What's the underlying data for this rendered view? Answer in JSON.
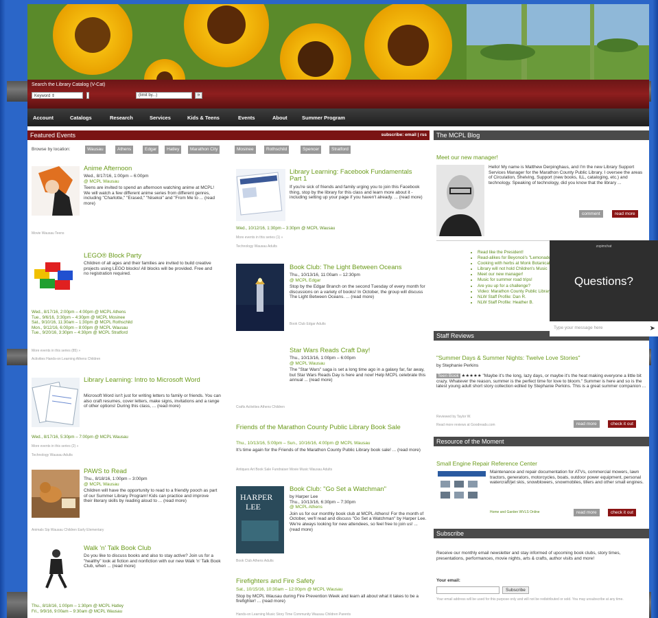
{
  "search": {
    "label": "Search the Library Catalog (V-Cat)",
    "field_select": "Keyword ⇕",
    "limit_select": "(limit by...)",
    "go": "»"
  },
  "nav": [
    "Account",
    "Catalogs",
    "Research",
    "Services",
    "Kids & Teens",
    "Events",
    "About",
    "Summer Program"
  ],
  "featured": {
    "title": "Featured Events",
    "subscribe": "subscribe: email | rss",
    "browse_label": "Browse by location:",
    "locations": [
      "Wausau",
      "Athens",
      "Edgar",
      "Hatley",
      "Marathon City",
      "Mosinee",
      "Rothschild",
      "Spencer",
      "Stratford"
    ]
  },
  "left_events": [
    {
      "title": "Anime Afternoon",
      "when": "Wed., 8/17/16, 1:00pm – 6:00pm",
      "where": "@ MCPL Wausau",
      "desc": "Teens are invited to spend an afternoon watching anime at MCPL! We will watch a few different anime series from different genres, including \"Charlotte,\" \"Erased,\" \"Nisekoi\" and \"From Me to ... (read more)",
      "tags": "Movie   Wausau   Teens"
    },
    {
      "title": "LEGO® Block Party",
      "desc": "Children of all ages and their families are invited to build creative projects using LEGO blocks! All blocks will be provided. Free and no registration required.",
      "dates": [
        "Wed., 8/17/16, 2:00pm – 4:00pm @ MCPL Athens",
        "Tue., 9/6/16, 3:30pm – 4:30pm @ MCPL Mosinee",
        "Sat., 9/10/16, 11:30am – 1:30pm @ MCPL Rothschild",
        "Mon., 9/12/16, 6:00pm – 8:00pm @ MCPL Wausau",
        "Tue., 9/20/16, 3:30pm – 4:30pm @ MCPL Stratford"
      ],
      "more": "More events in this series (85) »",
      "tags": "Activities   Hands-on Learning   Athens   Children"
    },
    {
      "title": "Library Learning: Intro to Microsoft Word",
      "desc": "Microsoft Word isn't just for writing letters to family or friends. You can also craft resumes, cover letters, make signs, invitations and a range of other options! During this class, ... (read more)",
      "dates": [
        "Wed., 8/17/16, 5:30pm – 7:00pm @ MCPL Wausau"
      ],
      "more": "More events in this series (2) »",
      "tags": "Technology   Wausau   Adults"
    },
    {
      "title": "PAWS to Read",
      "when": "Thu., 8/18/16, 1:00pm – 3:00pm",
      "where": "@ MCPL Wausau",
      "desc": "Children will have the opportunity to read to a friendly pooch as part of our Summer Library Program! Kids can practice and improve their literary skills by reading aloud to ... (read more)",
      "tags": "Animals   Sip   Wausau   Children   Early Elementary"
    },
    {
      "title": "Walk 'n' Talk Book Club",
      "desc": "Do you like to discuss books and also to stay active? Join us for a \"healthy\" look at fiction and nonfiction with our new Walk 'n' Talk Book Club, when ... (read more)",
      "dates": [
        "Thu., 8/18/16, 1:00pm – 1:30pm @ MCPL Hatley",
        "Fri., 9/9/16, 9:00am – 9:30am @ MCPL Wausau"
      ]
    }
  ],
  "mid_events": [
    {
      "title": "Library Learning: Facebook Fundamentals Part 1",
      "desc": "If you're sick of friends and family urging you to join this Facebook thing, stop by the library for this class and learn more about it - including setting up your page if you haven't already. ... (read more)",
      "dates": [
        "Wed., 10/12/16, 1:30pm – 3:30pm @ MCPL Wausau"
      ],
      "more": "More events in this series (1) »",
      "tags": "Technology   Wausau   Adults"
    },
    {
      "title": "Book Club: The Light Between Oceans",
      "when": "Thu., 10/13/16, 11:00am – 12:30pm",
      "where": "@ MCPL Edgar",
      "desc": "Stop by the Edgar Branch on the second Tuesday of every month for discussions on a variety of books! In October, the group will discuss The Light Between Oceans. ... (read more)",
      "tags": "Book Club   Edgar   Adults"
    },
    {
      "title": "Star Wars Reads Craft Day!",
      "when": "Thu., 10/13/16, 1:00pm – 6:00pm",
      "where": "@ MCPL Wausau",
      "desc": "The \"Star Wars\" saga is set a long time ago in a galaxy far, far away, but Star Wars Reads Day is here and now! Help MCPL celebrate this annual ... (read more)",
      "tags": "Crafts   Activities   Athens   Children"
    },
    {
      "title": "Friends of the Marathon County Public Library Book Sale",
      "when": "Thu., 10/13/16, 5:00pm – Sun., 10/16/16, 4:00pm @ MCPL Wausau",
      "desc": "It's time again for the Friends of the Marathon County Public Library book sale! ... (read more)",
      "tags": "Antiques   Art   Book Sale   Fundraiser   Movie   Music   Wausau   Adults"
    },
    {
      "title": "Book Club: \"Go Set a Watchman\"",
      "by": "by Harper Lee",
      "when": "Thu., 10/13/16, 6:30pm – 7:30pm",
      "where": "@ MCPL Athens",
      "desc": "Join us for our monthly book club at MCPL Athens! For the month of October, we'll read and discuss \"Go Set a Watchman\" by Harper Lee. We're always looking for new attendees, so feel free to join us! ... (read more)",
      "tags": "Book Club   Athens   Adults"
    },
    {
      "title": "Firefighters and Fire Safety",
      "when": "Sat., 10/15/16, 10:30am – 12:00pm @ MCPL Wausau",
      "desc": "Stop by MCPL Wausau during Fire Prevention Week and learn all about what it takes to be a firefighter! ... (read more)",
      "tags": "Hands-on Learning   Music   Story Time   Community   Wausau   Children   Parents"
    }
  ],
  "blog": {
    "title": "The MCPL Blog",
    "post_title": "Meet our new manager!",
    "post_text": "Hello! My name is Matthew Derpinghaus, and I'm the new Library Support Services Manager for the Marathon County Public Library. I oversee the areas of Circulation, Shelving, Support (new books, ILL, cataloging, etc.) and technology. Speaking of technology, did you know that the library ...",
    "comment": "comment",
    "read_more": "read more",
    "links": [
      "Read like the President!",
      "Read-alikes for Beyoncé's \"Lemonade\"",
      "Cooking with herbs at Monk Botanical Gardens",
      "Library will not hold Children's Music",
      "Meet our new manager!",
      "Music for summer road trips!",
      "Are you up for a challenge?",
      "Video: Marathon County Public Library",
      "NLW Staff Profile: Dan R.",
      "NLW Staff Profile: Heather B."
    ]
  },
  "chat": {
    "brand": "zopimchat",
    "question": "Questions?",
    "placeholder": "Type your message here",
    "send": "➤"
  },
  "reviews": {
    "title": "Staff Reviews",
    "book": "\"Summer Days & Summer Nights: Twelve Love Stories\"",
    "author": "by Stephanie Perkins",
    "badge": "Teen Book",
    "stars": "★★★★★",
    "text": "\"Maybe it's the long, lazy days, or maybe it's the heat making everyone a little bit crazy. Whatever the reason, summer is the perfect time for love to bloom.\" Summer is here and so is the latest young adult short story collection edited by Stephanie Perkins. This is a great summer companion ...",
    "reviewer": "Reviewed by Taylor W.",
    "more_reviews": "Read more reviews at Goodreads.com",
    "read_more": "read more",
    "check": "check it out"
  },
  "resource": {
    "title": "Resource of the Moment",
    "name": "Small Engine Repair Reference Center",
    "text": "Maintenance and repair documentation for ATVs, commercial mowers, lawn tractors, generators, motorcycles, boats, outdoor power equipment, personal watercraft/jet skis, snowblowers, snowmobiles, tillers and other small engines.",
    "tags": "Home and Garden   WVLS   Online",
    "read_more": "read more",
    "check": "check it out"
  },
  "subscribe": {
    "title": "Subscribe",
    "text": "Receive our monthly email newsletter and stay informed of upcoming book clubs, story times, presentations, performances, movie nights, arts & crafts, author visits and more!",
    "email_label": "Your email:",
    "button": "Subscribe",
    "note": "Your email address will be used for this purpose only and will not be redistributed or sold. You may unsubscribe at any time."
  }
}
